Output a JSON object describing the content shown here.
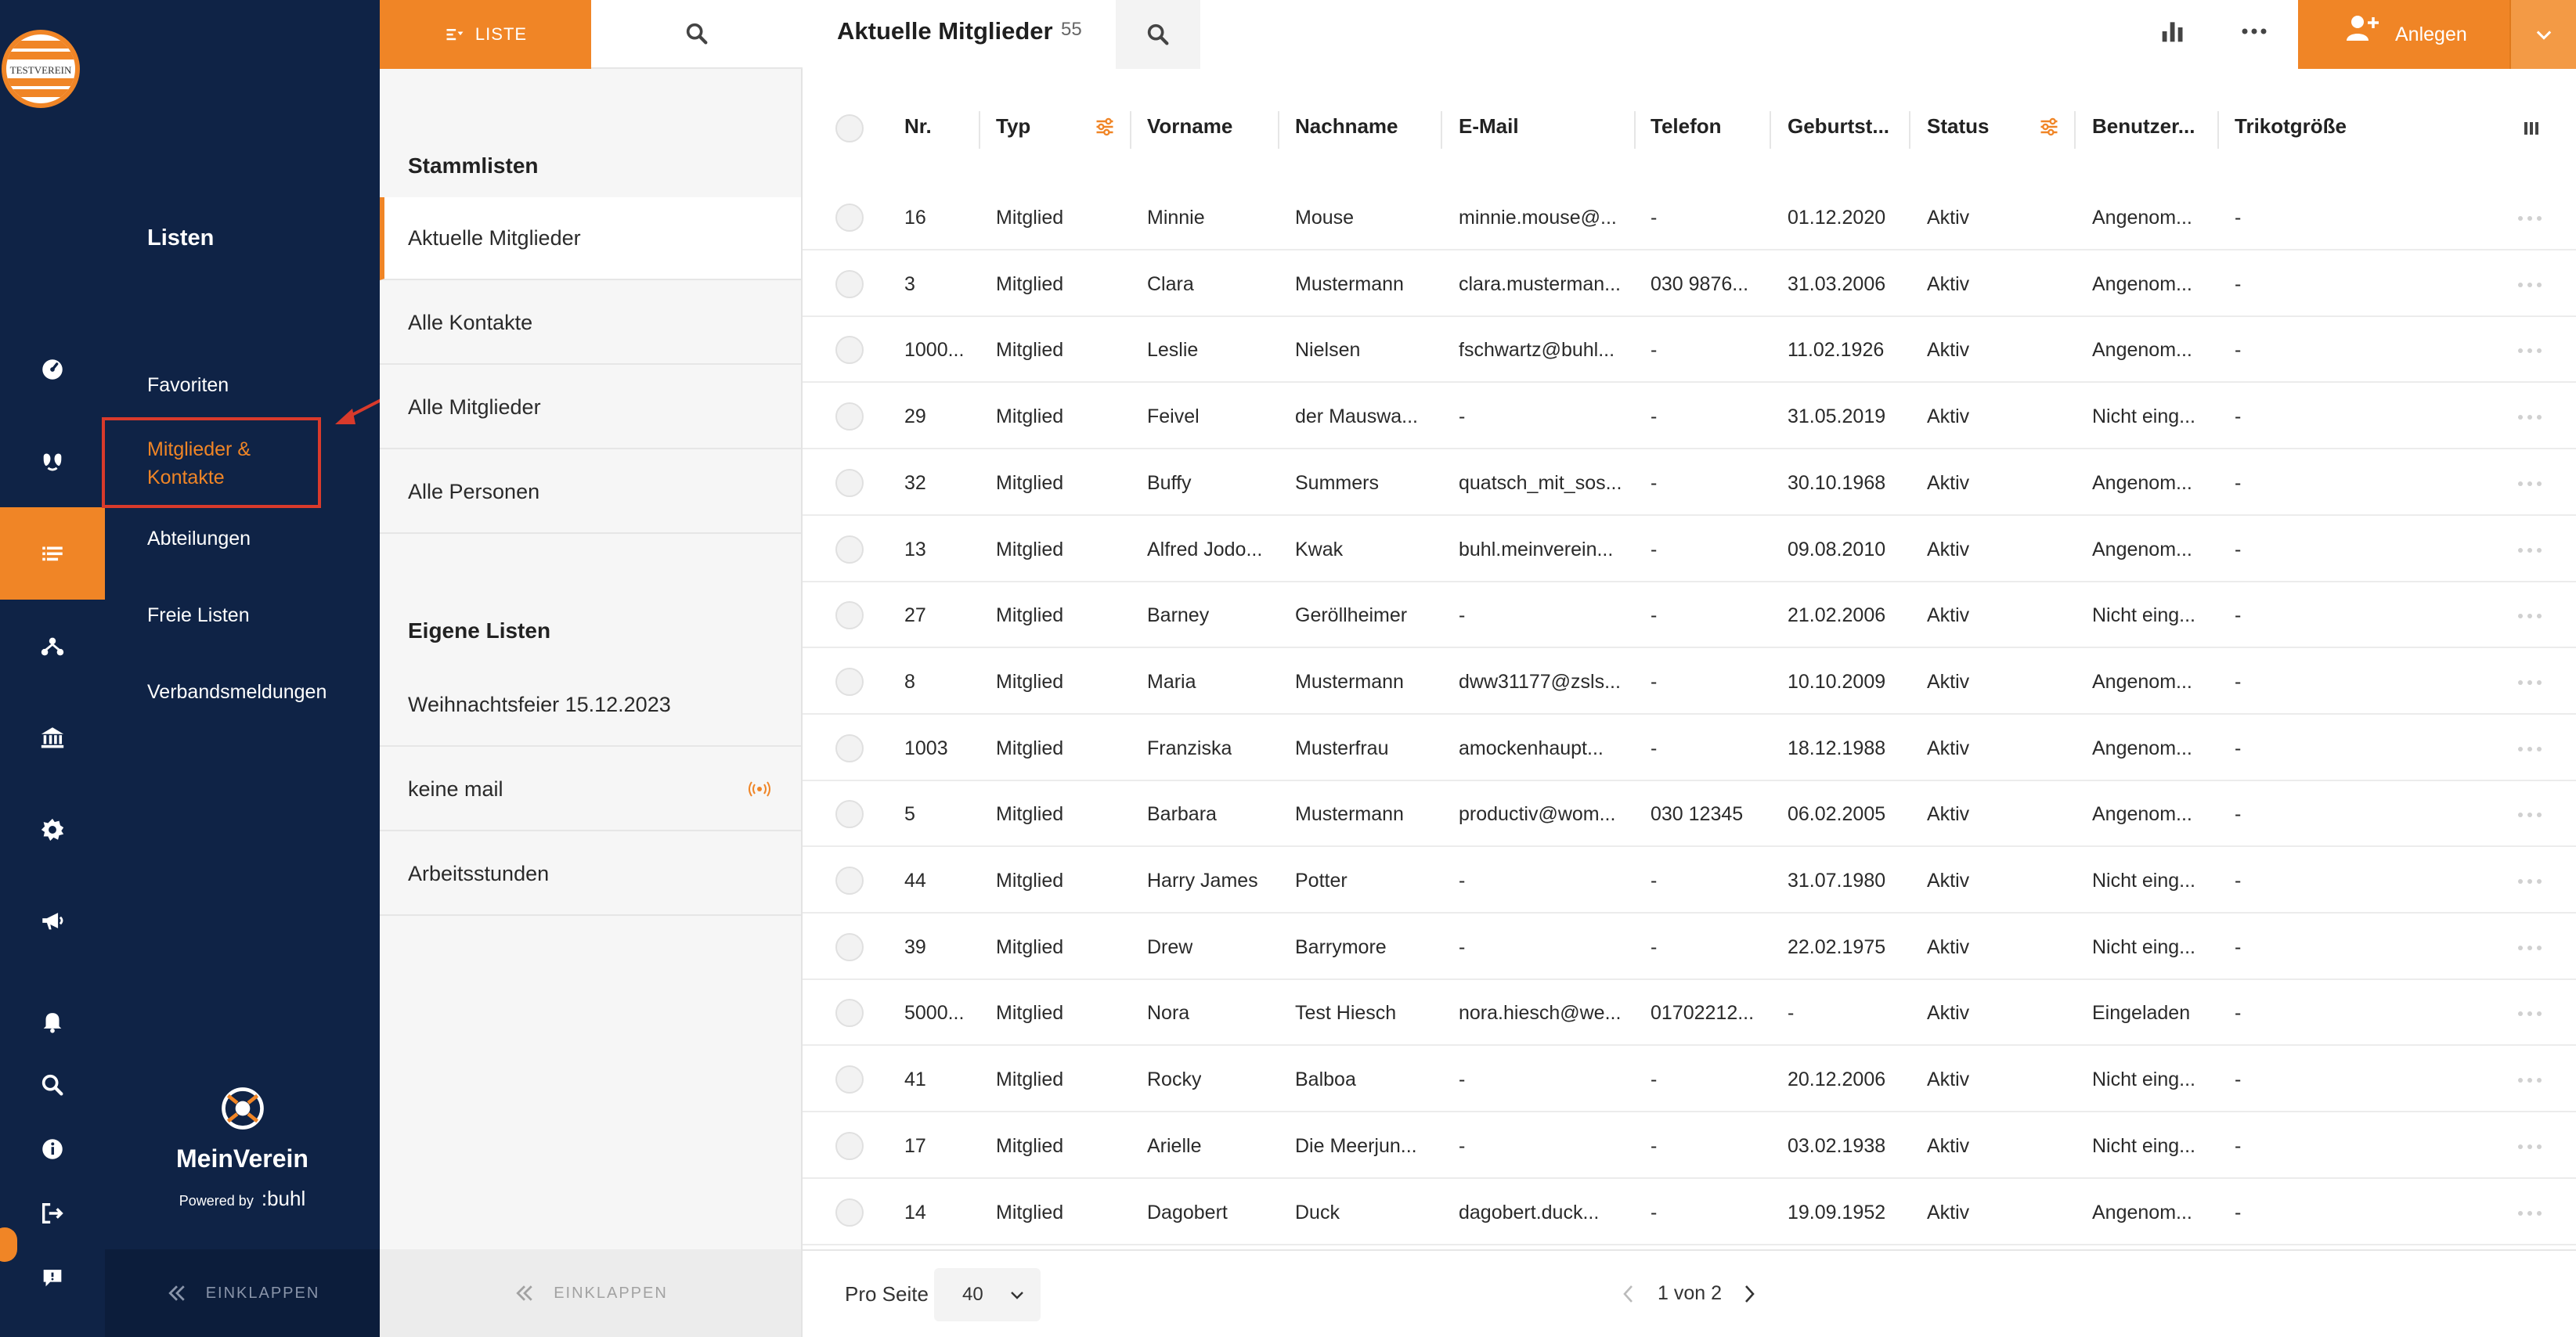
{
  "rail": {
    "logo_text": "TESTVEREIN",
    "icons": [
      "dashboard-icon",
      "members-icon",
      "lists-icon",
      "organisation-icon",
      "bank-icon",
      "settings-icon",
      "megaphone-icon",
      "bell-icon",
      "search-icon",
      "info-icon",
      "logout-icon",
      "feedback-icon"
    ],
    "active_icon": "lists-icon"
  },
  "nav": {
    "title": "Listen",
    "items": [
      {
        "label": "Favoriten"
      },
      {
        "label": "Mitglieder & Kontakte",
        "active": true
      },
      {
        "label": "Abteilungen"
      },
      {
        "label": "Freie Listen"
      },
      {
        "label": "Verbandsmeldungen"
      }
    ],
    "brand_name": "MeinVerein",
    "brand_powered": "Powered by",
    "brand_company": ":buhl",
    "collapse_label": "EINKLAPPEN"
  },
  "lists": {
    "tab_list_label": "LISTE",
    "section_master": "Stammlisten",
    "master_items": [
      {
        "label": "Aktuelle Mitglieder",
        "active": true
      },
      {
        "label": "Alle Kontakte"
      },
      {
        "label": "Alle Mitglieder"
      },
      {
        "label": "Alle Personen"
      }
    ],
    "section_own": "Eigene Listen",
    "own_items": [
      {
        "label": "Weihnachtsfeier 15.12.2023"
      },
      {
        "label": "keine mail",
        "shared": true
      },
      {
        "label": "Arbeitsstunden"
      }
    ],
    "collapse_label": "EINKLAPPEN"
  },
  "main": {
    "title": "Aktuelle Mitglieder",
    "count": "55",
    "create_label": "Anlegen",
    "columns": [
      "Nr.",
      "Typ",
      "Vorname",
      "Nachname",
      "E-Mail",
      "Telefon",
      "Geburtst...",
      "Status",
      "Benutzer...",
      "Trikotgröße"
    ],
    "rows": [
      [
        "16",
        "Mitglied",
        "Minnie",
        "Mouse",
        "minnie.mouse@...",
        "-",
        "01.12.2020",
        "Aktiv",
        "Angenom...",
        "-"
      ],
      [
        "3",
        "Mitglied",
        "Clara",
        "Mustermann",
        "clara.musterman...",
        "030 9876...",
        "31.03.2006",
        "Aktiv",
        "Angenom...",
        "-"
      ],
      [
        "1000...",
        "Mitglied",
        "Leslie",
        "Nielsen",
        "fschwartz@buhl...",
        "-",
        "11.02.1926",
        "Aktiv",
        "Angenom...",
        "-"
      ],
      [
        "29",
        "Mitglied",
        "Feivel",
        "der Mauswa...",
        "-",
        "-",
        "31.05.2019",
        "Aktiv",
        "Nicht eing...",
        "-"
      ],
      [
        "32",
        "Mitglied",
        "Buffy",
        "Summers",
        "quatsch_mit_sos...",
        "-",
        "30.10.1968",
        "Aktiv",
        "Angenom...",
        "-"
      ],
      [
        "13",
        "Mitglied",
        "Alfred Jodo...",
        "Kwak",
        "buhl.meinverein...",
        "-",
        "09.08.2010",
        "Aktiv",
        "Angenom...",
        "-"
      ],
      [
        "27",
        "Mitglied",
        "Barney",
        "Geröllheimer",
        "-",
        "-",
        "21.02.2006",
        "Aktiv",
        "Nicht eing...",
        "-"
      ],
      [
        "8",
        "Mitglied",
        "Maria",
        "Mustermann",
        "dww31177@zsls...",
        "-",
        "10.10.2009",
        "Aktiv",
        "Angenom...",
        "-"
      ],
      [
        "1003",
        "Mitglied",
        "Franziska",
        "Musterfrau",
        "amockenhaupt...",
        "-",
        "18.12.1988",
        "Aktiv",
        "Angenom...",
        "-"
      ],
      [
        "5",
        "Mitglied",
        "Barbara",
        "Mustermann",
        "productiv@wom...",
        "030 12345",
        "06.02.2005",
        "Aktiv",
        "Angenom...",
        "-"
      ],
      [
        "44",
        "Mitglied",
        "Harry James",
        "Potter",
        "-",
        "-",
        "31.07.1980",
        "Aktiv",
        "Nicht eing...",
        "-"
      ],
      [
        "39",
        "Mitglied",
        "Drew",
        "Barrymore",
        "-",
        "-",
        "22.02.1975",
        "Aktiv",
        "Nicht eing...",
        "-"
      ],
      [
        "5000...",
        "Mitglied",
        "Nora",
        "Test Hiesch",
        "nora.hiesch@we...",
        "01702212...",
        "-",
        "Aktiv",
        "Eingeladen",
        "-"
      ],
      [
        "41",
        "Mitglied",
        "Rocky",
        "Balboa",
        "-",
        "-",
        "20.12.2006",
        "Aktiv",
        "Nicht eing...",
        "-"
      ],
      [
        "17",
        "Mitglied",
        "Arielle",
        "Die Meerjun...",
        "-",
        "-",
        "03.02.1938",
        "Aktiv",
        "Nicht eing...",
        "-"
      ],
      [
        "14",
        "Mitglied",
        "Dagobert",
        "Duck",
        "dagobert.duck...",
        "-",
        "19.09.1952",
        "Aktiv",
        "Angenom...",
        "-"
      ]
    ],
    "per_page_label": "Pro Seite",
    "per_page_value": "40",
    "page_text": "1 von 2"
  },
  "colors": {
    "navy": "#0f2346",
    "accent": "#f08526",
    "annotation": "#d93a2b"
  }
}
